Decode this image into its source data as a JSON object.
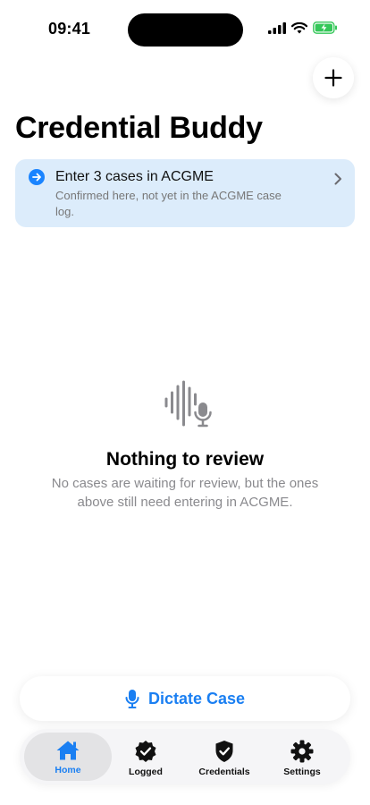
{
  "status_bar": {
    "time": "09:41"
  },
  "header": {
    "title": "Credential Buddy",
    "add_icon": "plus-icon"
  },
  "banner": {
    "title": "Enter 3 cases in ACGME",
    "subtitle": "Confirmed here, not yet in the ACGME case log.",
    "icon": "arrow-right-circle-icon",
    "accent_color": "#1a84ff",
    "background_color": "#dcecfb"
  },
  "empty_state": {
    "icon": "waveform-mic-icon",
    "title": "Nothing to review",
    "message": "No cases are waiting for review, but the ones above still need entering in ACGME."
  },
  "dictate": {
    "label": "Dictate Case",
    "icon": "mic-icon",
    "color": "#1a7ff2"
  },
  "tabs": [
    {
      "label": "Home",
      "icon": "house-icon",
      "active": true
    },
    {
      "label": "Logged",
      "icon": "checkmark-seal-icon",
      "active": false
    },
    {
      "label": "Credentials",
      "icon": "checkmark-shield-icon",
      "active": false
    },
    {
      "label": "Settings",
      "icon": "gear-icon",
      "active": false
    }
  ]
}
